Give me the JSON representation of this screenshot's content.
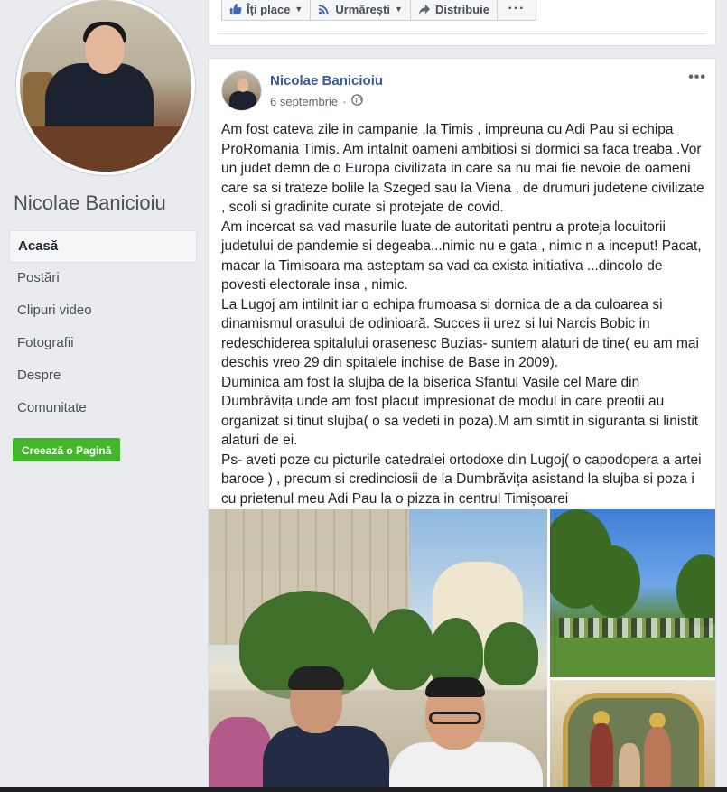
{
  "profile": {
    "name": "Nicolae Banicioiu"
  },
  "nav": {
    "items": [
      "Acasă",
      "Postări",
      "Clipuri video",
      "Fotografii",
      "Despre",
      "Comunitate"
    ],
    "active_index": 0
  },
  "create_page_label": "Creează o Pagină",
  "actions": {
    "like_label": "Îți place",
    "follow_label": "Urmărești",
    "share_label": "Distribuie",
    "more_label": "···"
  },
  "post": {
    "author": "Nicolae Banicioiu",
    "date": "6 septembrie",
    "privacy_icon": "globe-icon",
    "menu_label": "•••",
    "paragraphs": [
      "Am fost cateva zile in campanie ,la Timis , impreuna cu Adi Pau si echipa ProRomania Timis. Am intalnit oameni ambitiosi si dormici sa faca treaba .Vor un judet demn de o Europa civilizata in care sa nu mai fie nevoie de oameni care sa si trateze bolile la Szeged sau la Viena , de drumuri judetene civilizate , scoli si gradinite curate si protejate de covid.",
      "Am incercat sa vad masurile luate de autoritati pentru a proteja locuitorii judetului de pandemie si degeaba...nimic nu e gata , nimic n a inceput! Pacat, macar la Timisoara ma asteptam sa vad ca exista initiativa ...dincolo de povesti electorale insa , nimic.",
      "La Lugoj am intilnit iar o echipa frumoasa si dornica de a da culoarea si dinamismul orasului de odinioară. Succes ii urez si lui Narcis Bobic in redeschiderea spitalului orasenesc Buzias- suntem alaturi de tine( eu am mai deschis vreo 29 din spitalele inchise de Base in 2009).",
      "Duminica am fost la slujba de la biserica Sfantul Vasile cel Mare din Dumbrăvița unde am fost placut impresionat de modul in care preotii au organizat si tinut slujba( o sa vedeti in poza).M am simtit in siguranta si linistit alaturi de ei.",
      "Ps- aveti poze cu picturile catedralei ortodoxe din Lugoj( o capodopera a artei baroce ) , precum si credinciosii de la Dumbrăvița asistand la slujba si poza i cu prietenul meu Adi Pau la o pizza in centrul Timișoarei"
    ]
  },
  "colors": {
    "link_blue": "#385898",
    "create_green": "#42b72a",
    "background": "#e9ebee"
  }
}
